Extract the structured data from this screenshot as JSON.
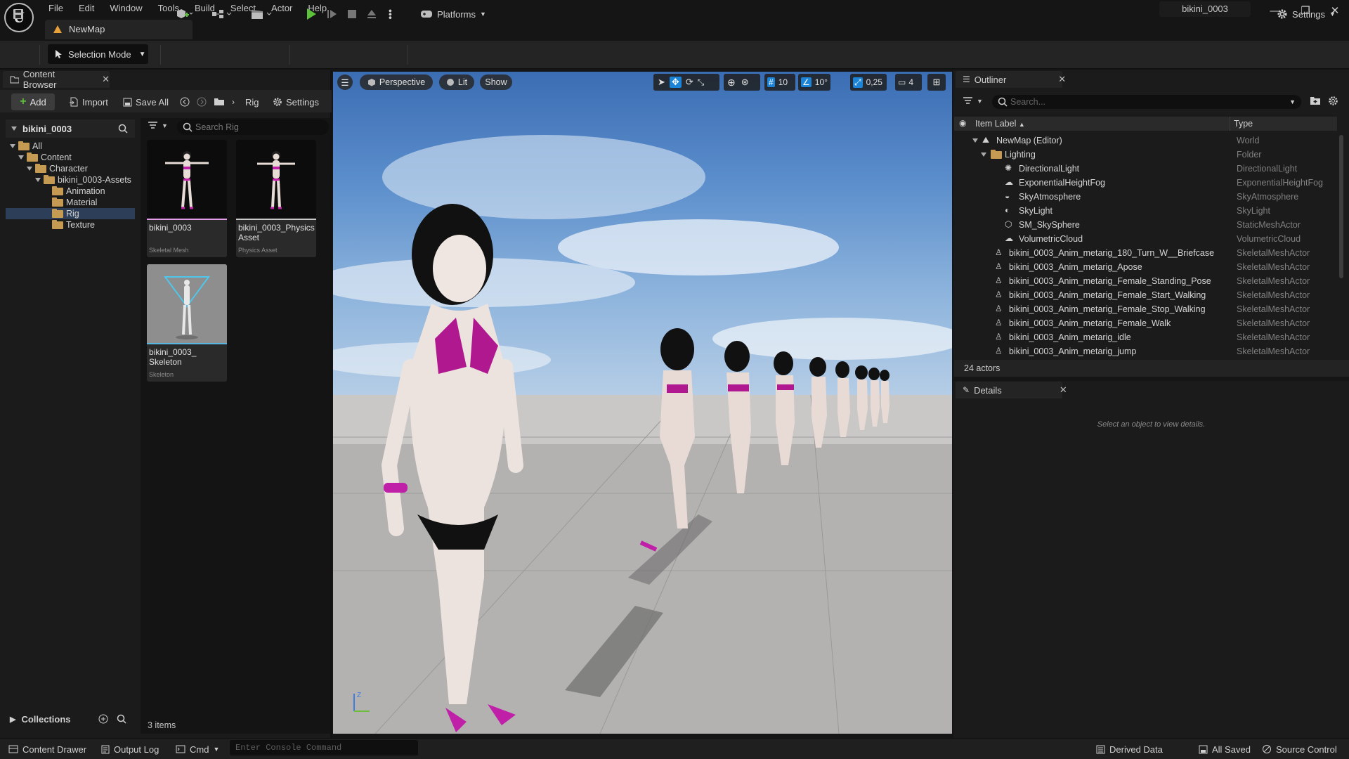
{
  "app": {
    "logo_text": "U"
  },
  "menu": [
    "File",
    "Edit",
    "Window",
    "Tools",
    "Build",
    "Select",
    "Actor",
    "Help"
  ],
  "project_name": "bikini_0003",
  "window_controls": {
    "minimize": "—",
    "restore": "❐",
    "close": "✕"
  },
  "map_tab": {
    "label": "NewMap"
  },
  "toolbar": {
    "selection_mode": "Selection Mode",
    "platforms": "Platforms",
    "settings": "Settings"
  },
  "content_browser": {
    "tab_label": "Content Browser",
    "add_label": "Add",
    "import_label": "Import",
    "save_all_label": "Save All",
    "path_current": "Rig",
    "settings_label": "Settings",
    "tree_root": "bikini_0003",
    "tree": [
      {
        "label": "All",
        "depth": 0,
        "expanded": true
      },
      {
        "label": "Content",
        "depth": 1,
        "expanded": true
      },
      {
        "label": "Character",
        "depth": 2,
        "expanded": true
      },
      {
        "label": "bikini_0003-Assets",
        "depth": 3,
        "expanded": true
      },
      {
        "label": "Animation",
        "depth": 4,
        "expanded": false
      },
      {
        "label": "Material",
        "depth": 4,
        "expanded": false
      },
      {
        "label": "Rig",
        "depth": 4,
        "expanded": false,
        "selected": true
      },
      {
        "label": "Texture",
        "depth": 4,
        "expanded": false
      }
    ],
    "collections_label": "Collections",
    "search_placeholder": "Search Rig",
    "assets": [
      {
        "name": "bikini_0003",
        "type": "Skeletal Mesh",
        "color": "#e29ce8"
      },
      {
        "name": "bikini_0003_Physics Asset",
        "type": "Physics Asset",
        "color": "#c8c8c8"
      },
      {
        "name": "bikini_0003_ Skeleton",
        "type": "Skeleton",
        "color": "#56b6e0"
      }
    ],
    "items_count": "3 items"
  },
  "viewport": {
    "perspective_label": "Perspective",
    "lit_label": "Lit",
    "show_label": "Show",
    "grid_snap": "10",
    "rotation_snap": "10°",
    "scale_snap": "0,25",
    "camera_speed": "4",
    "axis_z": "Z"
  },
  "outliner": {
    "tab_label": "Outliner",
    "search_placeholder": "Search...",
    "col_label": "Item Label",
    "col_type": "Type",
    "rows": [
      {
        "label": "NewMap (Editor)",
        "type": "World",
        "indent": 0,
        "icon": "world-icon"
      },
      {
        "label": "Lighting",
        "type": "Folder",
        "indent": 1,
        "icon": "folder-icon"
      },
      {
        "label": "DirectionalLight",
        "type": "DirectionalLight",
        "indent": 2,
        "icon": "sun-icon"
      },
      {
        "label": "ExponentialHeightFog",
        "type": "ExponentialHeightFog",
        "indent": 2,
        "icon": "fog-icon"
      },
      {
        "label": "SkyAtmosphere",
        "type": "SkyAtmosphere",
        "indent": 2,
        "icon": "atmosphere-icon"
      },
      {
        "label": "SkyLight",
        "type": "SkyLight",
        "indent": 2,
        "icon": "skylight-icon"
      },
      {
        "label": "SM_SkySphere",
        "type": "StaticMeshActor",
        "indent": 2,
        "icon": "mesh-icon"
      },
      {
        "label": "VolumetricCloud",
        "type": "VolumetricCloud",
        "indent": 2,
        "icon": "cloud-icon"
      },
      {
        "label": "bikini_0003_Anim_metarig_180_Turn_W__Briefcase",
        "type": "SkeletalMeshActor",
        "indent": 1,
        "icon": "skeletal-icon"
      },
      {
        "label": "bikini_0003_Anim_metarig_Apose",
        "type": "SkeletalMeshActor",
        "indent": 1,
        "icon": "skeletal-icon"
      },
      {
        "label": "bikini_0003_Anim_metarig_Female_Standing_Pose",
        "type": "SkeletalMeshActor",
        "indent": 1,
        "icon": "skeletal-icon"
      },
      {
        "label": "bikini_0003_Anim_metarig_Female_Start_Walking",
        "type": "SkeletalMeshActor",
        "indent": 1,
        "icon": "skeletal-icon"
      },
      {
        "label": "bikini_0003_Anim_metarig_Female_Stop_Walking",
        "type": "SkeletalMeshActor",
        "indent": 1,
        "icon": "skeletal-icon"
      },
      {
        "label": "bikini_0003_Anim_metarig_Female_Walk",
        "type": "SkeletalMeshActor",
        "indent": 1,
        "icon": "skeletal-icon"
      },
      {
        "label": "bikini_0003_Anim_metarig_idle",
        "type": "SkeletalMeshActor",
        "indent": 1,
        "icon": "skeletal-icon"
      },
      {
        "label": "bikini_0003_Anim_metarig_jump",
        "type": "SkeletalMeshActor",
        "indent": 1,
        "icon": "skeletal-icon"
      }
    ],
    "actor_count": "24 actors"
  },
  "details": {
    "tab_label": "Details",
    "empty_message": "Select an object to view details."
  },
  "statusbar": {
    "content_drawer": "Content Drawer",
    "output_log": "Output Log",
    "cmd": "Cmd",
    "console_placeholder": "Enter Console Command",
    "derived_data": "Derived Data",
    "all_saved": "All Saved",
    "source_control": "Source Control"
  },
  "colors": {
    "accent_blue": "#1c84d6",
    "play_green": "#5cc23a",
    "selection": "#2c3e58",
    "bikini_magenta": "#c01fa8"
  }
}
